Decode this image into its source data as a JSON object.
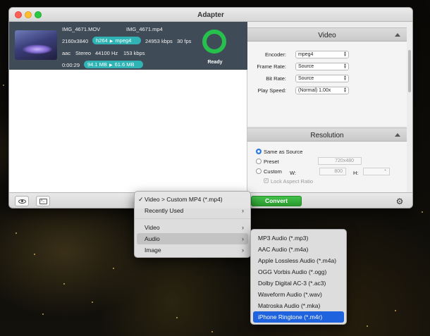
{
  "window": {
    "title": "Adapter"
  },
  "file": {
    "input_name": "IMG_4671.MOV",
    "output_name": "IMG_4671.mp4",
    "resolution": "2160x3840",
    "codec_in": "h264",
    "codec_out": "mpeg4",
    "bitrate": "24953 kbps",
    "fps": "30 fps",
    "audio_codec": "aac",
    "audio_channels": "Stereo",
    "sample_rate": "44100 Hz",
    "audio_bitrate": "153 kbps",
    "duration": "0:00:29",
    "size_in": "94.1 MB",
    "size_out": "61.6 MB",
    "status": "Ready"
  },
  "video": {
    "header": "Video",
    "encoder_label": "Encoder:",
    "encoder_value": "mpeg4",
    "framerate_label": "Frame Rate:",
    "framerate_value": "Source",
    "bitrate_label": "Bit Rate:",
    "bitrate_value": "Source",
    "playspeed_label": "Play Speed:",
    "playspeed_value": "(Normal) 1.00x"
  },
  "resolution": {
    "header": "Resolution",
    "same_as_source": "Same as Source",
    "preset": "Preset",
    "preset_value": "720x480",
    "custom": "Custom",
    "w_label": "W:",
    "w_value": "800",
    "h_label": "H:",
    "h_value": "*",
    "lock_aspect": "Lock Aspect Ratio"
  },
  "bottombar": {
    "convert_label": "Convert"
  },
  "format_menu": {
    "checked_item": "Video > Custom MP4 (*.mp4)",
    "items": [
      "Recently Used",
      "Video",
      "Audio",
      "Image"
    ]
  },
  "audio_menu": {
    "items": [
      "MP3 Audio (*.mp3)",
      "AAC Audio (*.m4a)",
      "Apple Lossless Audio (*.m4a)",
      "OGG Vorbis Audio (*.ogg)",
      "Dolby Digital AC-3 (*.ac3)",
      "Waveform Audio (*.wav)",
      "Matroska Audio (*.mka)",
      "iPhone Ringtone (*.m4r)"
    ]
  },
  "colors": {
    "accent_teal": "#2fb3b5",
    "ready_green": "#27c04c",
    "convert_green": "#2a9a2f",
    "selection_blue": "#1f63de",
    "file_row_bg": "#3f4b57"
  }
}
